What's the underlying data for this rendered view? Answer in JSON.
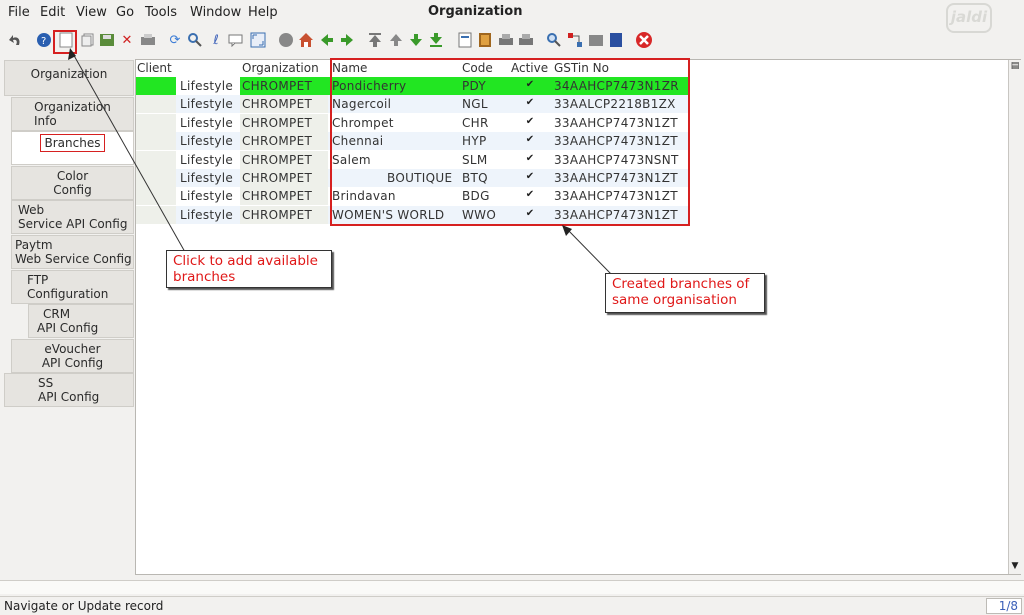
{
  "window": {
    "title": "Organization",
    "logo": "jaldi"
  },
  "menu": [
    "File",
    "Edit",
    "View",
    "Go",
    "Tools",
    "Window",
    "Help"
  ],
  "toolbar": {
    "icons": [
      "undo-icon",
      "help-icon",
      "new-record-icon",
      "copy-icon",
      "save-icon",
      "delete-icon",
      "print-icon",
      "refresh-icon",
      "find-icon",
      "attachment-icon",
      "chat-icon",
      "expand-icon",
      "history-icon",
      "home-icon",
      "back-icon",
      "forward-icon",
      "first-record-icon",
      "previous-record-icon",
      "next-record-icon",
      "last-record-icon",
      "report-icon",
      "archive-icon",
      "print-preview-icon",
      "print-icon-2",
      "zoom-across-icon",
      "workflow-icon",
      "request-icon",
      "product-info-icon",
      "exit-icon"
    ]
  },
  "tabs": [
    {
      "line1": "Organization",
      "line2": ""
    },
    {
      "line1": "Organization",
      "line2": "Info"
    },
    {
      "line1": "Branches",
      "line2": ""
    },
    {
      "line1": "Color",
      "line2": "Config"
    },
    {
      "line1": "Web",
      "line2": "Service API Config"
    },
    {
      "line1": "Paytm",
      "line2": "Web Service Config"
    },
    {
      "line1": "FTP",
      "line2": "Configuration"
    },
    {
      "line1": "CRM",
      "line2": "API Config"
    },
    {
      "line1": "eVoucher",
      "line2": "API Config"
    },
    {
      "line1": "SS",
      "line2": "API Config"
    }
  ],
  "grid": {
    "columns": [
      "Client",
      "Organization",
      "Name",
      "Code",
      "Active",
      "GSTin No"
    ],
    "rows": [
      {
        "client": "Lifestyle",
        "org": "CHROMPET",
        "name": "Pondicherry",
        "code": "PDY",
        "active": true,
        "gstin": "34AAHCP7473N1ZR"
      },
      {
        "client": "Lifestyle",
        "org": "CHROMPET",
        "name": "Nagercoil",
        "code": "NGL",
        "active": true,
        "gstin": "33AALCP2218B1ZX"
      },
      {
        "client": "Lifestyle",
        "org": "CHROMPET",
        "name": "Chrompet",
        "code": "CHR",
        "active": true,
        "gstin": "33AAHCP7473N1ZT"
      },
      {
        "client": "Lifestyle",
        "org": "CHROMPET",
        "name": "Chennai",
        "code": "HYP",
        "active": true,
        "gstin": "33AAHCP7473N1ZT"
      },
      {
        "client": "Lifestyle",
        "org": "CHROMPET",
        "name": "Salem",
        "code": "SLM",
        "active": true,
        "gstin": "33AAHCP7473NSNT"
      },
      {
        "client": "Lifestyle",
        "org": "CHROMPET",
        "name": "BOUTIQUE",
        "code": "BTQ",
        "active": true,
        "gstin": "33AAHCP7473N1ZT"
      },
      {
        "client": "Lifestyle",
        "org": "CHROMPET",
        "name": "Brindavan",
        "code": "BDG",
        "active": true,
        "gstin": "33AAHCP7473N1ZT"
      },
      {
        "client": "Lifestyle",
        "org": "CHROMPET",
        "name": "WOMEN'S WORLD",
        "code": "WWO",
        "active": true,
        "gstin": "33AAHCP7473N1ZT"
      }
    ],
    "selected_row": 0,
    "selected_color": "#22e622"
  },
  "annotations": {
    "add": [
      "Click to add available",
      "branches"
    ],
    "created": [
      "Created branches of",
      "same organisation"
    ],
    "color": "#e01818"
  },
  "status": {
    "text": "Navigate or Update record",
    "record": "1/8"
  }
}
